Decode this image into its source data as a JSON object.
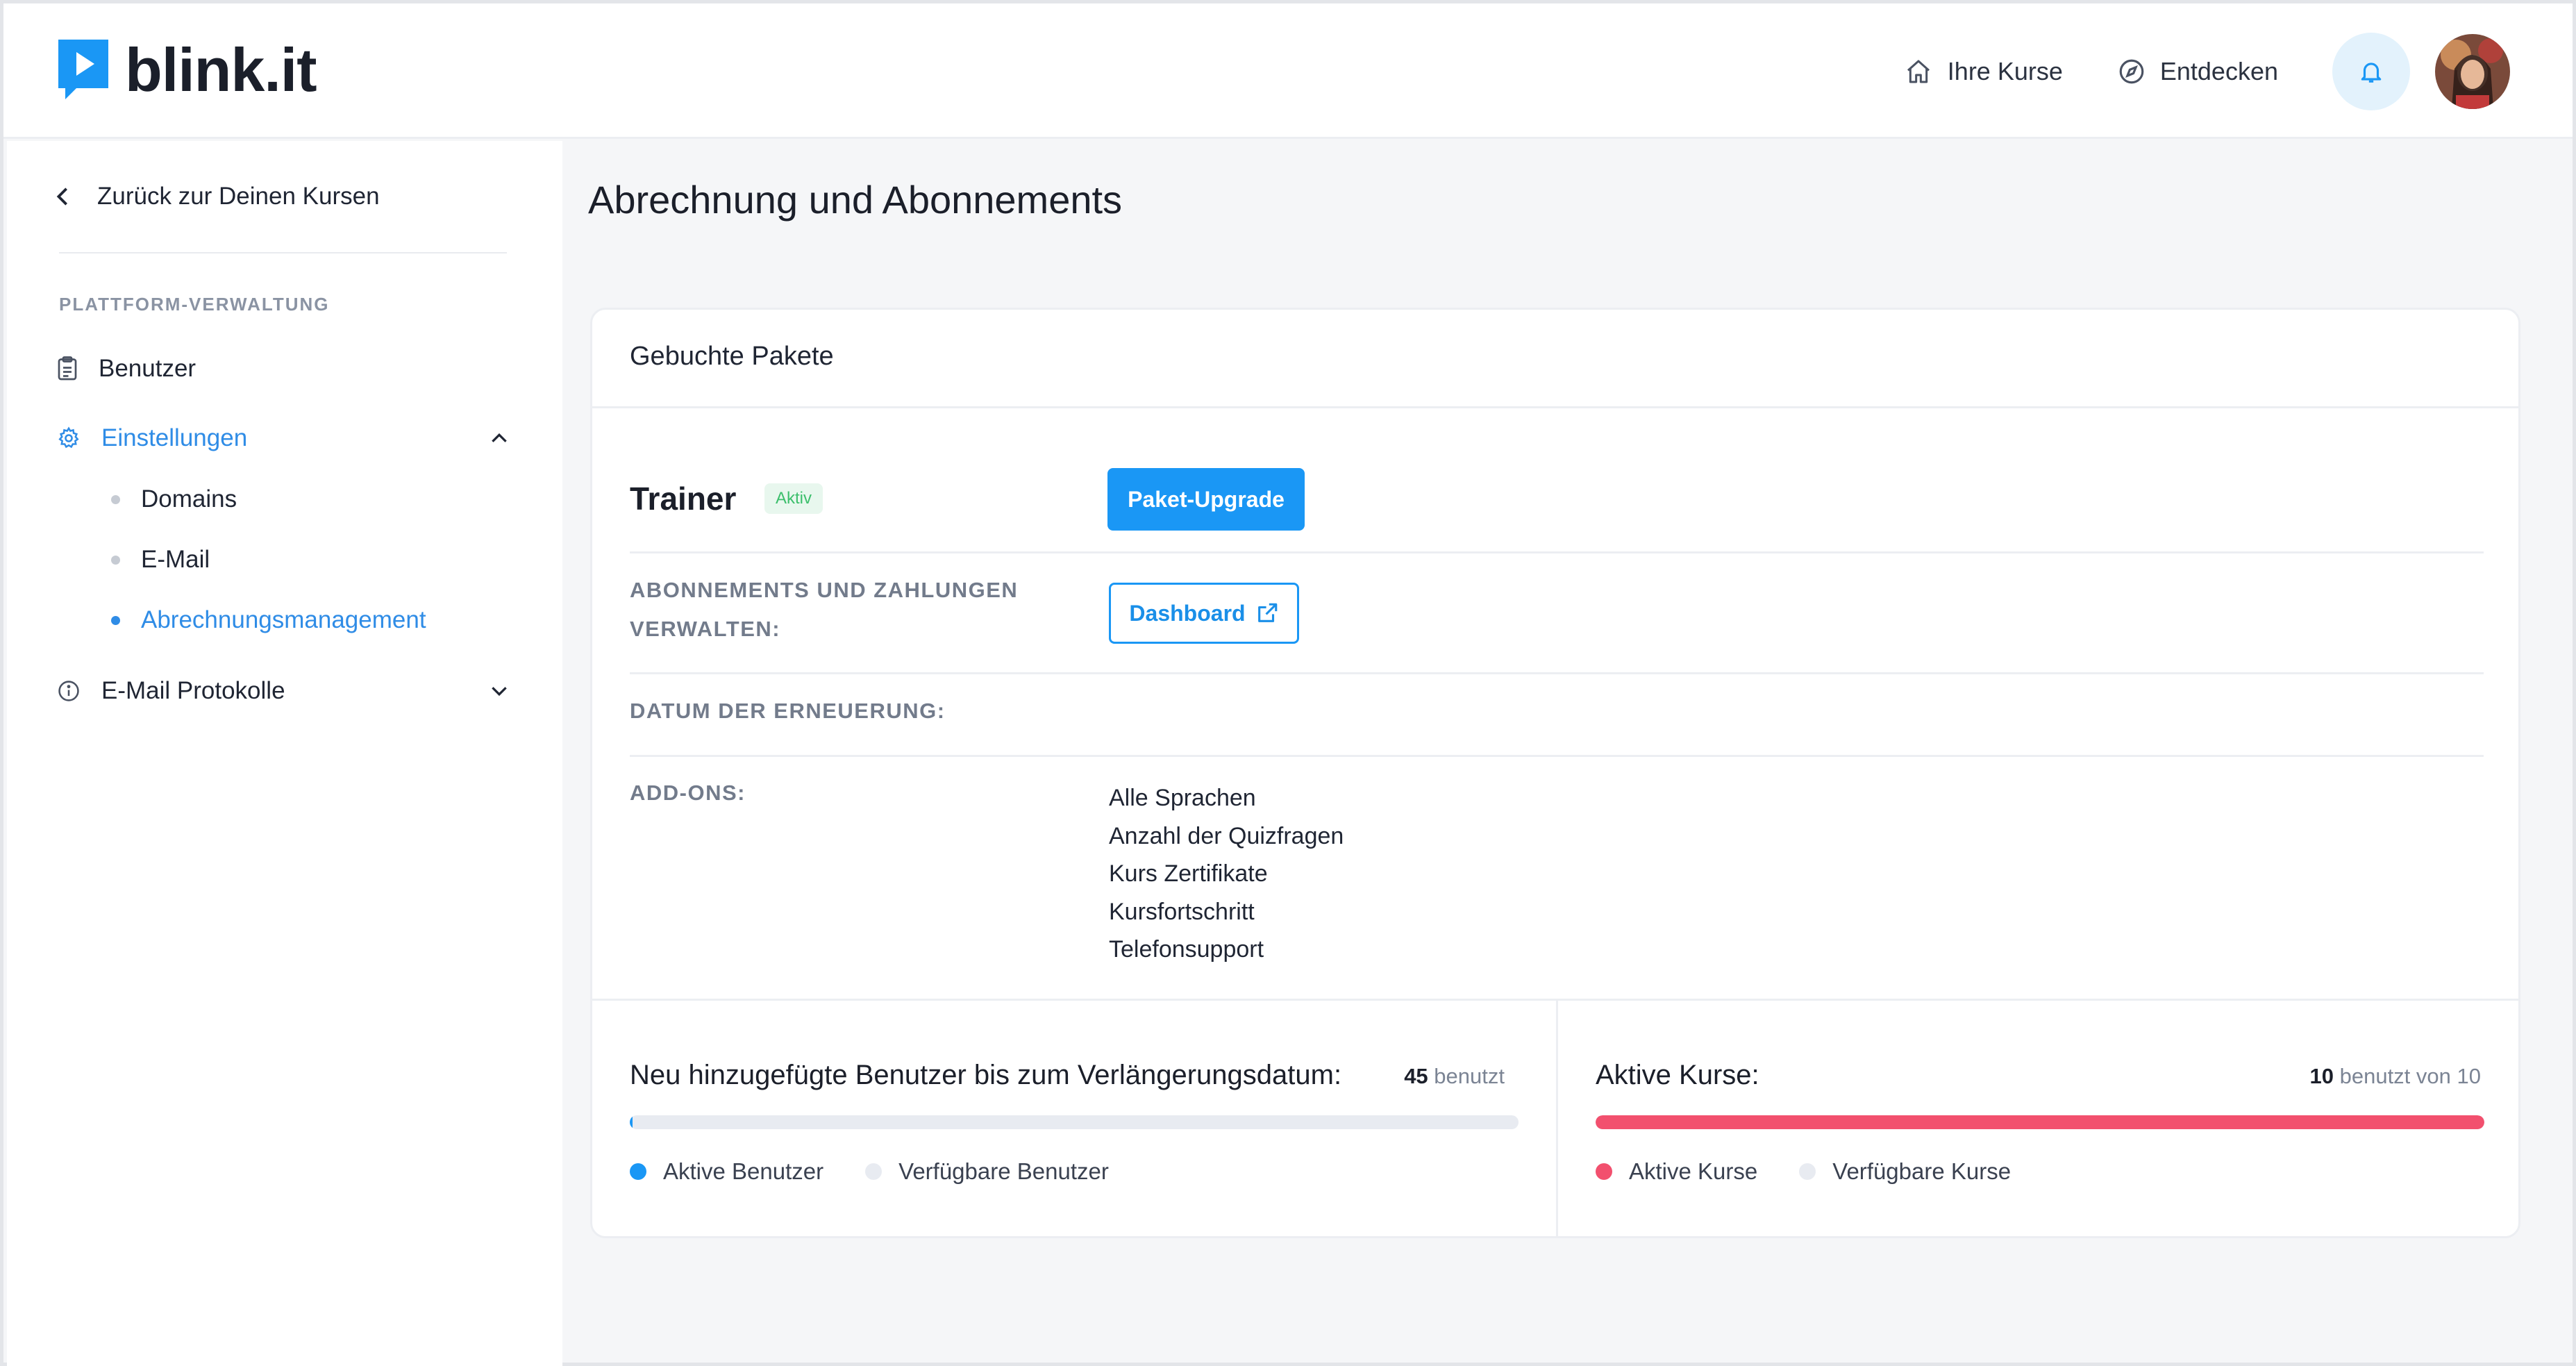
{
  "brand": {
    "name": "blink.it",
    "color": "#1a97f5"
  },
  "header": {
    "nav": [
      {
        "label": "Ihre Kurse",
        "icon": "home-icon"
      },
      {
        "label": "Entdecken",
        "icon": "compass-icon"
      }
    ],
    "bell_icon": "bell-icon",
    "avatar": "user-avatar"
  },
  "sidebar": {
    "back_label": "Zurück zur Deinen Kursen",
    "section_title": "PLATTFORM-VERWALTUNG",
    "items": [
      {
        "label": "Benutzer",
        "icon": "clipboard-icon"
      },
      {
        "label": "Einstellungen",
        "icon": "gear-icon",
        "expanded": true
      },
      {
        "label": "E-Mail Protokolle",
        "icon": "info-icon",
        "expanded": false
      }
    ],
    "settings_sub": [
      {
        "label": "Domains"
      },
      {
        "label": "E-Mail"
      },
      {
        "label": "Abrechnungsmanagement",
        "active": true
      }
    ]
  },
  "main": {
    "title": "Abrechnung und Abonnements",
    "card_title": "Gebuchte Pakete",
    "plan": {
      "name": "Trainer",
      "status": "Aktiv",
      "upgrade_label": "Paket-Upgrade"
    },
    "manage_label": "ABONNEMENTS UND ZAHLUNGEN VERWALTEN:",
    "dashboard_label": "Dashboard",
    "renewal_label": "DATUM DER ERNEUERUNG:",
    "renewal_value": "",
    "addons_label": "ADD-ONS:",
    "addons": [
      "Alle Sprachen",
      "Anzahl der Quizfragen",
      "Kurs Zertifikate",
      "Kursfortschritt",
      "Telefonsupport"
    ],
    "users_stat": {
      "title": "Neu hinzugefügte Benutzer bis zum Verlängerungsdatum:",
      "used": "45",
      "used_suffix": "benutzt",
      "fill_fraction": 0.003,
      "legend_active": "Aktive Benutzer",
      "legend_available": "Verfügbare Benutzer",
      "active_color": "#1a97f5",
      "available_color": "#e8ebf1"
    },
    "courses_stat": {
      "title": "Aktive Kurse:",
      "used": "10",
      "used_suffix": "benutzt von 10",
      "fill_fraction": 1.0,
      "legend_active": "Aktive Kurse",
      "legend_available": "Verfügbare Kurse",
      "active_color": "#f2506e",
      "available_color": "#e8ebf1"
    }
  }
}
